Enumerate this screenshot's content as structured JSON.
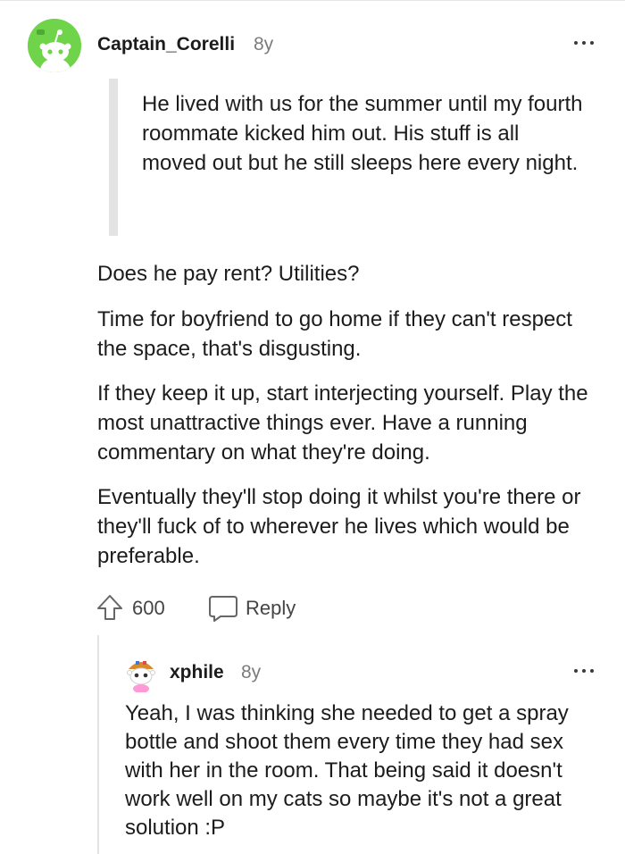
{
  "parent_comment": {
    "username": "Captain_Corelli",
    "age": "8y",
    "avatar_color": "#6fd44a",
    "quote": "He lived with us for the summer until my fourth roommate kicked him out. His stuff is all moved out but he still sleeps here every night.",
    "paragraphs": [
      "Does he pay rent? Utilities?",
      "Time for boyfriend to go home if they can't respect the space, that's disgusting.",
      "If they keep it up, start interjecting yourself. Play the most unattractive things ever. Have a running commentary on what they're doing.",
      "Eventually they'll stop doing it whilst you're there or they'll fuck of to wherever he lives which would be preferable."
    ],
    "upvotes": "600",
    "reply_label": "Reply",
    "icons": {
      "upvote": "upvote-arrow-icon",
      "reply": "speech-bubble-icon",
      "more": "more-options-icon"
    }
  },
  "child_comment": {
    "username": "xphile",
    "age": "8y",
    "text": "Yeah, I was thinking she needed to get a spray bottle and shoot them every time they had sex with her in the room. That being said it doesn't work well on my cats so maybe it's not a great solution :P"
  }
}
